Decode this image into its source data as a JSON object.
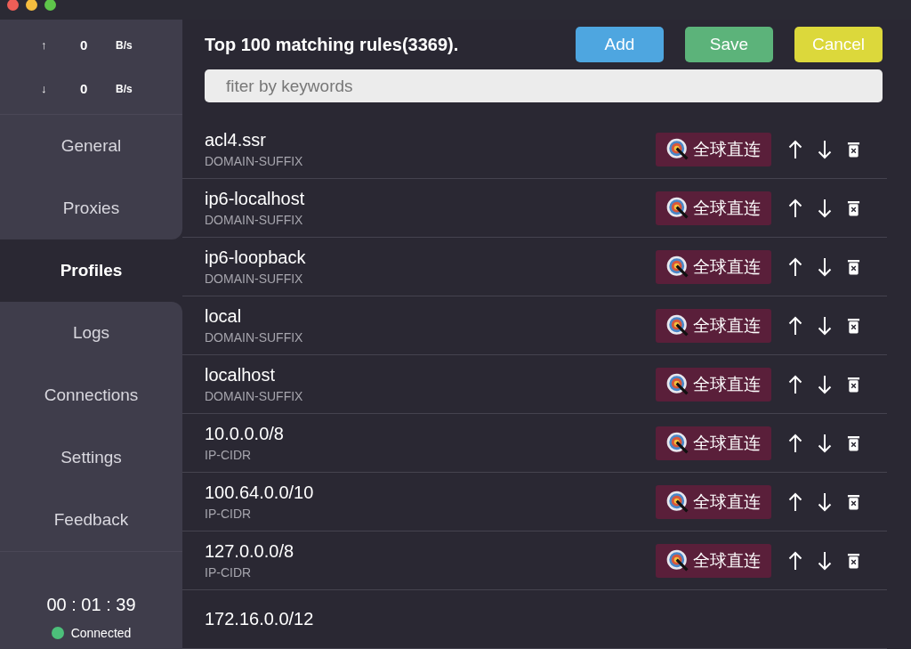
{
  "speed": [
    {
      "arrow": "↑",
      "value": "0",
      "unit": "B/s"
    },
    {
      "arrow": "↓",
      "value": "0",
      "unit": "B/s"
    }
  ],
  "sidebar": {
    "items": [
      {
        "label": "General",
        "selected": false
      },
      {
        "label": "Proxies",
        "selected": false
      },
      {
        "label": "Profiles",
        "selected": true
      },
      {
        "label": "Logs",
        "selected": false
      },
      {
        "label": "Connections",
        "selected": false
      },
      {
        "label": "Settings",
        "selected": false
      },
      {
        "label": "Feedback",
        "selected": false
      }
    ]
  },
  "timer": "00 : 01 : 39",
  "status": {
    "label": "Connected",
    "color": "#4cbf7a"
  },
  "header": {
    "title": "Top 100 matching rules(3369).",
    "buttons": [
      {
        "label": "Add",
        "kind": "add"
      },
      {
        "label": "Save",
        "kind": "save"
      },
      {
        "label": "Cancel",
        "kind": "cancel"
      }
    ]
  },
  "filter": {
    "placeholder": "fiter by keywords"
  },
  "rules": [
    {
      "name": "acl4.ssr",
      "type": "DOMAIN-SUFFIX",
      "policy": "全球直连"
    },
    {
      "name": "ip6-localhost",
      "type": "DOMAIN-SUFFIX",
      "policy": "全球直连"
    },
    {
      "name": "ip6-loopback",
      "type": "DOMAIN-SUFFIX",
      "policy": "全球直连"
    },
    {
      "name": "local",
      "type": "DOMAIN-SUFFIX",
      "policy": "全球直连"
    },
    {
      "name": "localhost",
      "type": "DOMAIN-SUFFIX",
      "policy": "全球直连"
    },
    {
      "name": "10.0.0.0/8",
      "type": "IP-CIDR",
      "policy": "全球直连"
    },
    {
      "name": "100.64.0.0/10",
      "type": "IP-CIDR",
      "policy": "全球直连"
    },
    {
      "name": "127.0.0.0/8",
      "type": "IP-CIDR",
      "policy": "全球直连"
    },
    {
      "name": "172.16.0.0/12"
    }
  ]
}
